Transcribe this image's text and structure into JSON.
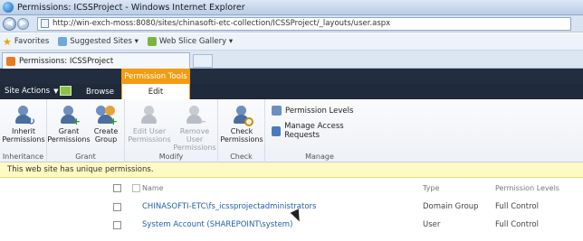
{
  "window": {
    "title": "Permissions: ICSSProject - Windows Internet Explorer"
  },
  "address": {
    "url": "http://win-exch-moss:8080/sites/chinasofti-etc-collection/ICSSProject/_layouts/user.aspx"
  },
  "favorites": {
    "label": "Favorites",
    "items": [
      "Suggested Sites ▾",
      "Web Slice Gallery ▾"
    ]
  },
  "tab": {
    "title": "Permissions: ICSSProject"
  },
  "sp_header": {
    "site_actions": "Site Actions",
    "browse": "Browse",
    "tool_group": "Permission Tools",
    "edit": "Edit"
  },
  "ribbon": {
    "groups": [
      {
        "label": "Inheritance",
        "buttons": [
          {
            "label": "Inherit Permissions",
            "enabled": true,
            "icon": "inherit-icon"
          }
        ]
      },
      {
        "label": "Grant",
        "buttons": [
          {
            "label": "Grant Permissions",
            "enabled": true,
            "icon": "grant-icon"
          },
          {
            "label": "Create Group",
            "enabled": true,
            "icon": "create-group-icon"
          }
        ]
      },
      {
        "label": "Modify",
        "buttons": [
          {
            "label": "Edit User Permissions",
            "enabled": false,
            "icon": "edit-user-icon"
          },
          {
            "label": "Remove User Permissions",
            "enabled": false,
            "icon": "remove-user-icon"
          }
        ]
      },
      {
        "label": "Check",
        "buttons": [
          {
            "label": "Check Permissions",
            "enabled": true,
            "icon": "check-icon"
          }
        ]
      },
      {
        "label": "Manage",
        "buttons": [
          {
            "label": "Permission Levels",
            "enabled": true,
            "icon": "permission-levels-icon"
          },
          {
            "label": "Manage Access Requests",
            "enabled": true,
            "icon": "access-requests-icon"
          }
        ]
      }
    ]
  },
  "message": "This web site has unique permissions.",
  "table": {
    "columns": [
      "Name",
      "Type",
      "Permission Levels"
    ],
    "rows": [
      {
        "name": "CHINASOFTI-ETC\\fs_icssprojectadministrators",
        "type": "Domain Group",
        "level": "Full Control"
      },
      {
        "name": "System Account (SHAREPOINT\\system)",
        "type": "User",
        "level": "Full Control"
      }
    ]
  },
  "colors": {
    "accent": "#f39c12",
    "header": "#1f2a3a",
    "link": "#1f5fa8",
    "message_bg": "#fff9c4"
  }
}
